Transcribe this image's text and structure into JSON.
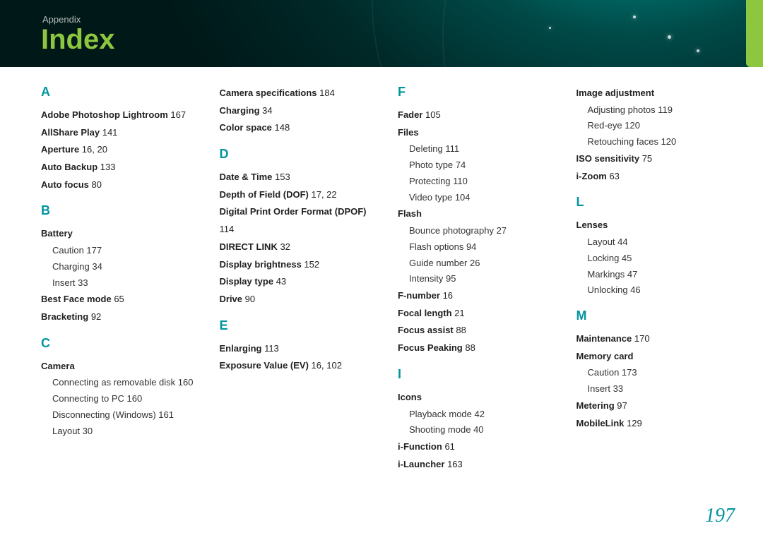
{
  "header": {
    "section": "Appendix",
    "title": "Index"
  },
  "page_number": "197",
  "columns": [
    [
      {
        "letter": "A"
      },
      {
        "entry": "Adobe Photoshop Lightroom",
        "pg": "167"
      },
      {
        "entry": "AllShare Play",
        "pg": "141"
      },
      {
        "entry": "Aperture",
        "pg": "16, 20"
      },
      {
        "entry": "Auto Backup",
        "pg": "133"
      },
      {
        "entry": "Auto focus",
        "pg": "80"
      },
      {
        "letter": "B"
      },
      {
        "entry": "Battery"
      },
      {
        "sub": "Caution",
        "pg": "177"
      },
      {
        "sub": "Charging",
        "pg": "34"
      },
      {
        "sub": "Insert",
        "pg": "33"
      },
      {
        "entry": "Best Face mode",
        "pg": "65"
      },
      {
        "entry": "Bracketing",
        "pg": "92"
      },
      {
        "letter": "C"
      },
      {
        "entry": "Camera"
      },
      {
        "sub": "Connecting as removable disk",
        "pg": "160"
      },
      {
        "sub": "Connecting to PC",
        "pg": "160"
      },
      {
        "sub": "Disconnecting (Windows)",
        "pg": "161"
      },
      {
        "sub": "Layout",
        "pg": "30"
      }
    ],
    [
      {
        "entry": "Camera specifications",
        "pg": "184"
      },
      {
        "entry": "Charging",
        "pg": "34"
      },
      {
        "entry": "Color space",
        "pg": "148"
      },
      {
        "letter": "D"
      },
      {
        "entry": "Date & Time",
        "pg": "153"
      },
      {
        "entry": "Depth of Field (DOF)",
        "pg": "17, 22"
      },
      {
        "entry": "Digital Print Order Format (DPOF)",
        "pg": "114"
      },
      {
        "entry": "DIRECT LINK",
        "pg": "32"
      },
      {
        "entry": "Display brightness",
        "pg": "152"
      },
      {
        "entry": "Display type",
        "pg": "43"
      },
      {
        "entry": "Drive",
        "pg": "90"
      },
      {
        "letter": "E"
      },
      {
        "entry": "Enlarging",
        "pg": "113"
      },
      {
        "entry": "Exposure Value (EV)",
        "pg": "16, 102"
      }
    ],
    [
      {
        "letter": "F"
      },
      {
        "entry": "Fader",
        "pg": "105"
      },
      {
        "entry": "Files"
      },
      {
        "sub": "Deleting",
        "pg": "111"
      },
      {
        "sub": "Photo type",
        "pg": "74"
      },
      {
        "sub": "Protecting",
        "pg": "110"
      },
      {
        "sub": "Video type",
        "pg": "104"
      },
      {
        "entry": "Flash"
      },
      {
        "sub": "Bounce photography",
        "pg": "27"
      },
      {
        "sub": "Flash options",
        "pg": "94"
      },
      {
        "sub": "Guide number",
        "pg": "26"
      },
      {
        "sub": "Intensity",
        "pg": "95"
      },
      {
        "entry": "F-number",
        "pg": "16"
      },
      {
        "entry": "Focal length",
        "pg": "21"
      },
      {
        "entry": "Focus assist",
        "pg": "88"
      },
      {
        "entry": "Focus Peaking",
        "pg": "88"
      },
      {
        "letter": "I"
      },
      {
        "entry": "Icons"
      },
      {
        "sub": "Playback mode",
        "pg": "42"
      },
      {
        "sub": "Shooting mode",
        "pg": "40"
      },
      {
        "entry": "i-Function",
        "pg": "61"
      },
      {
        "entry": "i-Launcher",
        "pg": "163"
      }
    ],
    [
      {
        "entry": "Image adjustment"
      },
      {
        "sub": "Adjusting photos",
        "pg": "119"
      },
      {
        "sub": "Red-eye",
        "pg": "120"
      },
      {
        "sub": "Retouching faces",
        "pg": "120"
      },
      {
        "entry": "ISO sensitivity",
        "pg": "75"
      },
      {
        "entry": "i-Zoom",
        "pg": "63"
      },
      {
        "letter": "L"
      },
      {
        "entry": "Lenses"
      },
      {
        "sub": "Layout",
        "pg": "44"
      },
      {
        "sub": "Locking",
        "pg": "45"
      },
      {
        "sub": "Markings",
        "pg": "47"
      },
      {
        "sub": "Unlocking",
        "pg": "46"
      },
      {
        "letter": "M"
      },
      {
        "entry": "Maintenance",
        "pg": "170"
      },
      {
        "entry": "Memory card"
      },
      {
        "sub": "Caution",
        "pg": "173"
      },
      {
        "sub": "Insert",
        "pg": "33"
      },
      {
        "entry": "Metering",
        "pg": "97"
      },
      {
        "entry": "MobileLink",
        "pg": "129"
      }
    ]
  ]
}
